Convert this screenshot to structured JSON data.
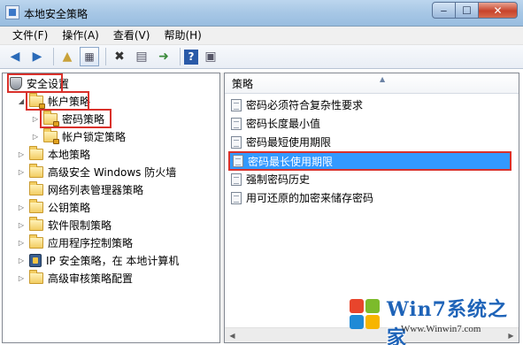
{
  "window": {
    "title": "本地安全策略"
  },
  "menu": [
    "文件(F)",
    "操作(A)",
    "查看(V)",
    "帮助(H)"
  ],
  "tree": {
    "root": "安全设置",
    "account_policy": "帐户策略",
    "password_policy": "密码策略",
    "lockout_policy": "帐户锁定策略",
    "local_policy": "本地策略",
    "firewall": "高级安全 Windows 防火墙",
    "netlist": "网络列表管理器策略",
    "pubkey": "公钥策略",
    "software": "软件限制策略",
    "appcontrol": "应用程序控制策略",
    "ipsec": "IP 安全策略，在 本地计算机",
    "audit": "高级审核策略配置"
  },
  "list": {
    "header": "策略",
    "items": [
      "密码必须符合复杂性要求",
      "密码长度最小值",
      "密码最短使用期限",
      "密码最长使用期限",
      "强制密码历史",
      "用可还原的加密来储存密码"
    ],
    "selected_index": 3
  },
  "watermark": {
    "text": "Win7系统之家",
    "url": "Www.Winwin7.com"
  },
  "colors": {
    "selection": "#3399ff",
    "highlight_box": "#d9302a",
    "title_bar": "#a9c8e6"
  }
}
